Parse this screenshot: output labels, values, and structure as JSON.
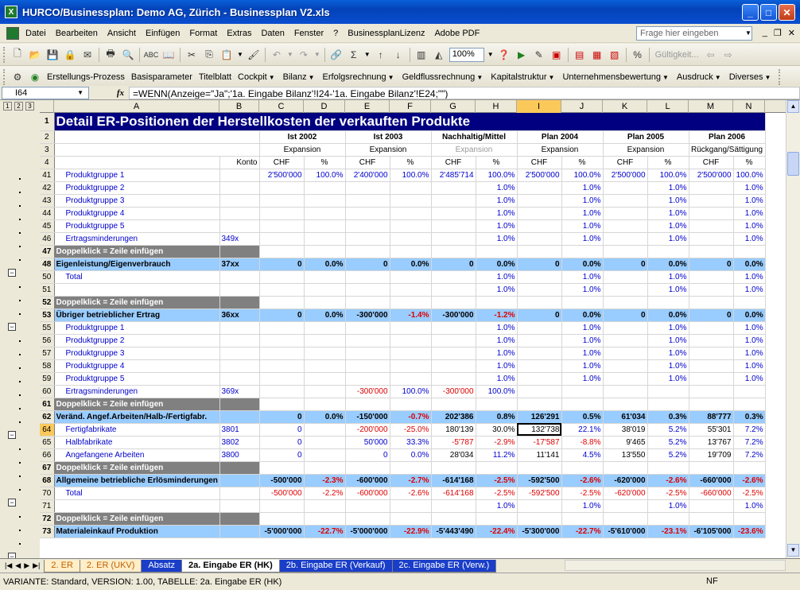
{
  "window": {
    "title": "HURCO/Businessplan: Demo AG, Zürich - Businessplan V2.xls",
    "app_icon": "X"
  },
  "menu": [
    "Datei",
    "Bearbeiten",
    "Ansicht",
    "Einfügen",
    "Format",
    "Extras",
    "Daten",
    "Fenster",
    "?",
    "BusinessplanLizenz",
    "Adobe PDF"
  ],
  "help_placeholder": "Frage hier eingeben",
  "toolbar": {
    "zoom": "100%",
    "validity": "Gültigkeit..."
  },
  "custom_menu": [
    {
      "label": "Erstellungs-Prozess",
      "dd": false
    },
    {
      "label": "Basisparameter",
      "dd": false
    },
    {
      "label": "Titelblatt",
      "dd": false
    },
    {
      "label": "Cockpit",
      "dd": true
    },
    {
      "label": "Bilanz",
      "dd": true
    },
    {
      "label": "Erfolgsrechnung",
      "dd": true
    },
    {
      "label": "Geldflussrechnung",
      "dd": true
    },
    {
      "label": "Kapitalstruktur",
      "dd": true
    },
    {
      "label": "Unternehmensbewertung",
      "dd": true
    },
    {
      "label": "Ausdruck",
      "dd": true
    },
    {
      "label": "Diverses",
      "dd": true
    }
  ],
  "formula_bar": {
    "cell": "I64",
    "formula": "=WENN(Anzeige=\"Ja\";'1a. Eingabe Bilanz'!I24-'1a. Eingabe Bilanz'!E24;\"\")"
  },
  "outline_levels": [
    "1",
    "2",
    "3"
  ],
  "columns": [
    "A",
    "B",
    "C",
    "D",
    "E",
    "F",
    "G",
    "H",
    "I",
    "J",
    "K",
    "L",
    "M",
    "N"
  ],
  "sheet_title": "Detail ER-Positionen der Herstellkosten der verkauften Produkte",
  "headers": {
    "row2": [
      "Ist 2002",
      "Ist 2003",
      "Nachhaltig/Mittel",
      "Plan 2004",
      "Plan 2005",
      "Plan 2006"
    ],
    "row3": [
      "Expansion",
      "Expansion",
      "Expansion",
      "Expansion",
      "Expansion",
      "Rückgang/Sättigung"
    ],
    "row4_account": "Konto",
    "row4_units": [
      "CHF",
      "%",
      "CHF",
      "%",
      "CHF",
      "%",
      "CHF",
      "%",
      "CHF",
      "%",
      "CHF",
      "%"
    ]
  },
  "rows": [
    {
      "n": "41",
      "t": "item",
      "a": "Produktgruppe 1",
      "b": "",
      "c": "2'500'000",
      "d": "100.0%",
      "e": "2'400'000",
      "f": "100.0%",
      "g": "2'485'714",
      "h": "100.0%",
      "i": "2'500'000",
      "j": "100.0%",
      "k": "2'500'000",
      "l": "100.0%",
      "m": "2'500'000",
      "nn": "100.0%"
    },
    {
      "n": "42",
      "t": "item",
      "a": "Produktgruppe 2",
      "h": "1.0%",
      "j": "1.0%",
      "l": "1.0%",
      "nn": "1.0%"
    },
    {
      "n": "43",
      "t": "item",
      "a": "Produktgruppe 3",
      "h": "1.0%",
      "j": "1.0%",
      "l": "1.0%",
      "nn": "1.0%"
    },
    {
      "n": "44",
      "t": "item",
      "a": "Produktgruppe 4",
      "h": "1.0%",
      "j": "1.0%",
      "l": "1.0%",
      "nn": "1.0%"
    },
    {
      "n": "45",
      "t": "item",
      "a": "Produktgruppe 5",
      "h": "1.0%",
      "j": "1.0%",
      "l": "1.0%",
      "nn": "1.0%"
    },
    {
      "n": "46",
      "t": "item",
      "a": "Ertragsminderungen",
      "b": "349x",
      "h": "1.0%",
      "j": "1.0%",
      "l": "1.0%",
      "nn": "1.0%"
    },
    {
      "n": "47",
      "t": "dk",
      "a": "Doppelklick = Zeile einfügen"
    },
    {
      "n": "48",
      "t": "sec",
      "a": "Eigenleistung/Eigenverbrauch",
      "b": "37xx",
      "c": "0",
      "d": "0.0%",
      "e": "0",
      "f": "0.0%",
      "g": "0",
      "h": "0.0%",
      "i": "0",
      "j": "0.0%",
      "k": "0",
      "l": "0.0%",
      "m": "0",
      "nn": "0.0%"
    },
    {
      "n": "50",
      "t": "item",
      "a": "Total",
      "h": "1.0%",
      "j": "1.0%",
      "l": "1.0%",
      "nn": "1.0%"
    },
    {
      "n": "51",
      "t": "item",
      "a": "",
      "h": "1.0%",
      "j": "1.0%",
      "l": "1.0%",
      "nn": "1.0%"
    },
    {
      "n": "52",
      "t": "dk",
      "a": "Doppelklick = Zeile einfügen"
    },
    {
      "n": "53",
      "t": "sec",
      "a": "Übriger betrieblicher Ertrag",
      "b": "36xx",
      "c": "0",
      "d": "0.0%",
      "e": "-300'000",
      "f": "-1.4%",
      "g": "-300'000",
      "h": "-1.2%",
      "i": "0",
      "j": "0.0%",
      "k": "0",
      "l": "0.0%",
      "m": "0",
      "nn": "0.0%"
    },
    {
      "n": "55",
      "t": "item",
      "a": "Produktgruppe 1",
      "h": "1.0%",
      "j": "1.0%",
      "l": "1.0%",
      "nn": "1.0%"
    },
    {
      "n": "56",
      "t": "item",
      "a": "Produktgruppe 2",
      "h": "1.0%",
      "j": "1.0%",
      "l": "1.0%",
      "nn": "1.0%"
    },
    {
      "n": "57",
      "t": "item",
      "a": "Produktgruppe 3",
      "h": "1.0%",
      "j": "1.0%",
      "l": "1.0%",
      "nn": "1.0%"
    },
    {
      "n": "58",
      "t": "item",
      "a": "Produktgruppe 4",
      "h": "1.0%",
      "j": "1.0%",
      "l": "1.0%",
      "nn": "1.0%"
    },
    {
      "n": "59",
      "t": "item",
      "a": "Produktgruppe 5",
      "h": "1.0%",
      "j": "1.0%",
      "l": "1.0%",
      "nn": "1.0%"
    },
    {
      "n": "60",
      "t": "item",
      "a": "Ertragsminderungen",
      "b": "369x",
      "e": "-300'000",
      "f": "100.0%",
      "g": "-300'000",
      "h": "100.0%"
    },
    {
      "n": "61",
      "t": "dk",
      "a": "Doppelklick = Zeile einfügen"
    },
    {
      "n": "62",
      "t": "sec",
      "a": "Veränd. Angef.Arbeiten/Halb-/Fertigfabr.",
      "c": "0",
      "d": "0.0%",
      "e": "-150'000",
      "f": "-0.7%",
      "g": "202'386",
      "h": "0.8%",
      "i": "126'291",
      "j": "0.5%",
      "k": "61'034",
      "l": "0.3%",
      "m": "88'777",
      "nn": "0.3%"
    },
    {
      "n": "64",
      "t": "item",
      "a": "Fertigfabrikate",
      "b": "3801",
      "c": "0",
      "e": "-200'000",
      "f": "-25.0%",
      "g": "180'139",
      "h": "30.0%",
      "i": "132'738",
      "j": "22.1%",
      "k": "38'019",
      "l": "5.2%",
      "m": "55'301",
      "nn": "7.2%"
    },
    {
      "n": "65",
      "t": "item",
      "a": "Halbfabrikate",
      "b": "3802",
      "c": "0",
      "e": "50'000",
      "f": "33.3%",
      "g": "-5'787",
      "h": "-2.9%",
      "i": "-17'587",
      "j": "-8.8%",
      "k": "9'465",
      "l": "5.2%",
      "m": "13'767",
      "nn": "7.2%"
    },
    {
      "n": "66",
      "t": "item",
      "a": "Angefangene Arbeiten",
      "b": "3800",
      "c": "0",
      "e": "0",
      "f": "0.0%",
      "g": "28'034",
      "h": "11.2%",
      "i": "11'141",
      "j": "4.5%",
      "k": "13'550",
      "l": "5.2%",
      "m": "19'709",
      "nn": "7.2%"
    },
    {
      "n": "67",
      "t": "dk",
      "a": "Doppelklick = Zeile einfügen"
    },
    {
      "n": "68",
      "t": "sec",
      "a": "Allgemeine betriebliche Erlösminderungen",
      "c": "-500'000",
      "d": "-2.3%",
      "e": "-600'000",
      "f": "-2.7%",
      "g": "-614'168",
      "h": "-2.5%",
      "i": "-592'500",
      "j": "-2.6%",
      "k": "-620'000",
      "l": "-2.6%",
      "m": "-660'000",
      "nn": "-2.6%"
    },
    {
      "n": "70",
      "t": "item",
      "a": "Total",
      "c": "-500'000",
      "d": "-2.2%",
      "e": "-600'000",
      "f": "-2.6%",
      "g": "-614'168",
      "h": "-2.5%",
      "i": "-592'500",
      "j": "-2.5%",
      "k": "-620'000",
      "l": "-2.5%",
      "m": "-660'000",
      "nn": "-2.5%"
    },
    {
      "n": "71",
      "t": "item",
      "a": "",
      "h": "1.0%",
      "j": "1.0%",
      "l": "1.0%",
      "nn": "1.0%"
    },
    {
      "n": "72",
      "t": "dk",
      "a": "Doppelklick = Zeile einfügen"
    },
    {
      "n": "73",
      "t": "sec",
      "a": "Materialeinkauf Produktion",
      "c": "-5'000'000",
      "d": "-22.7%",
      "e": "-5'000'000",
      "f": "-22.9%",
      "g": "-5'443'490",
      "h": "-22.4%",
      "i": "-5'300'000",
      "j": "-22.7%",
      "k": "-5'610'000",
      "l": "-23.1%",
      "m": "-6'105'000",
      "nn": "-23.6%"
    }
  ],
  "tabs": [
    {
      "label": "2. ER",
      "style": "orange"
    },
    {
      "label": "2. ER (UKV)",
      "style": "orange"
    },
    {
      "label": "Absatz",
      "style": "blue"
    },
    {
      "label": "2a. Eingabe ER (HK)",
      "style": "active"
    },
    {
      "label": "2b. Eingabe ER (Verkauf)",
      "style": "blue"
    },
    {
      "label": "2c. Eingabe ER (Verw.)",
      "style": "blue"
    }
  ],
  "status": {
    "text": "VARIANTE: Standard, VERSION: 1.00, TABELLE: 2a. Eingabe ER (HK)",
    "mode": "NF"
  }
}
